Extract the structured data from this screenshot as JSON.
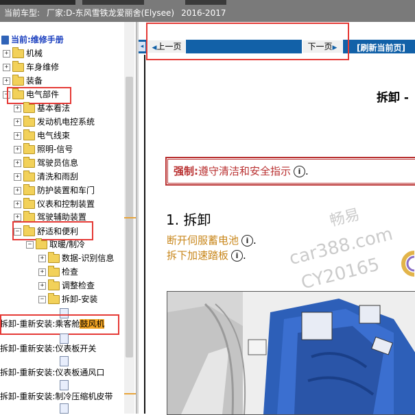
{
  "header": {
    "vehicle_label": "当前车型:",
    "vehicle_maker": "厂家:D-东风雪铁龙爱丽舍(Elysee)",
    "vehicle_years": "2016-2017"
  },
  "tree": {
    "root_label": "当前:维修手册",
    "top_items": [
      "机械",
      "车身维修",
      "装备",
      "电气部件"
    ],
    "electrical_items": [
      "基本看法",
      "发动机电控系统",
      "电气线束",
      "照明-信号",
      "驾驶员信息",
      "清洗和雨刮",
      "防护装置和车门",
      "仪表和控制装置",
      "驾驶辅助装置",
      "舒适和便利"
    ],
    "comfort_child": "取暖/制冷",
    "hvac_items": [
      "数据-识别信息",
      "检查",
      "调整检查",
      "拆卸-安装"
    ],
    "leaf_docs": [
      {
        "prefix": "拆卸-重新安装:乘客舱",
        "highlight": "鼓风机"
      },
      {
        "prefix": "拆卸-重新安装:仪表板开关",
        "highlight": ""
      },
      {
        "prefix": "拆卸-重新安装:仪表板通风口",
        "highlight": ""
      },
      {
        "prefix": "拆卸-重新安装:制冷压缩机皮带",
        "highlight": ""
      }
    ]
  },
  "nav": {
    "prev_label": "上一页",
    "next_label": "下一页",
    "refresh_label": "[刷新当前页]"
  },
  "content": {
    "doc_title": "拆卸 -",
    "warning_strong": "强制",
    "warning_sep": ":",
    "warning_text": "遵守清洁和安全指示",
    "section_title": "1. 拆卸",
    "steps": [
      "断开伺服蓄电池",
      "拆下加速踏板"
    ],
    "info_glyph": "i",
    "punct": "."
  },
  "watermark": {
    "line1": "畅易",
    "line2": "car388.com",
    "line3": "CY20165"
  },
  "colors": {
    "nav_blue": "#1261a8",
    "highlight_red": "#e53935",
    "warning_red": "#b93030",
    "step_orange": "#c8861a",
    "selected_orange": "#f5a623"
  }
}
